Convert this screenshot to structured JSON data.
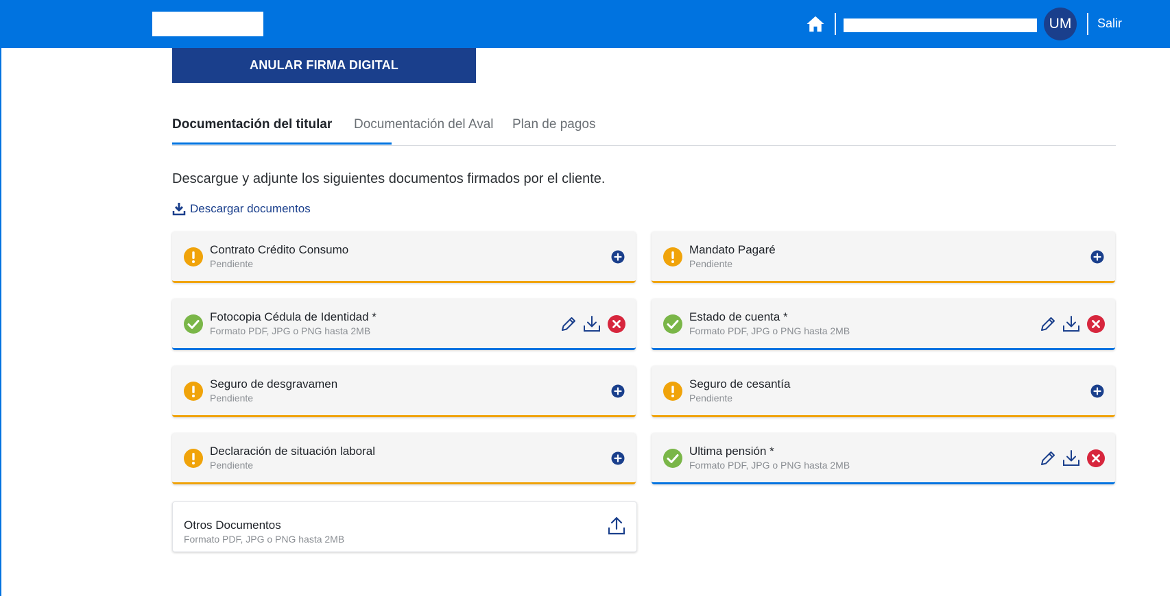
{
  "header": {
    "avatar_initials": "UM",
    "logout_label": "Salir",
    "bar_color": "#0073e0"
  },
  "annul_button_label": "ANULAR FIRMA DIGITAL",
  "tabs": [
    {
      "label": "Documentación del titular",
      "active": true
    },
    {
      "label": "Documentación del Aval",
      "active": false
    },
    {
      "label": "Plan de pagos",
      "active": false
    }
  ],
  "intro_text": "Descargue y adjunte los siguientes documentos firmados por el cliente.",
  "download_link_label": "Descargar documentos",
  "documents": [
    {
      "title": "Contrato Crédito Consumo",
      "subtitle": "Pendiente",
      "status": "pending"
    },
    {
      "title": "Mandato Pagaré",
      "subtitle": "Pendiente",
      "status": "pending"
    },
    {
      "title": "Fotocopia Cédula de Identidad *",
      "subtitle": "Formato PDF, JPG o PNG hasta 2MB",
      "status": "done"
    },
    {
      "title": "Estado de cuenta *",
      "subtitle": "Formato PDF, JPG o PNG hasta 2MB",
      "status": "done"
    },
    {
      "title": "Seguro de desgravamen",
      "subtitle": "Pendiente",
      "status": "pending"
    },
    {
      "title": "Seguro de cesantía",
      "subtitle": "Pendiente",
      "status": "pending"
    },
    {
      "title": "Declaración de situación laboral",
      "subtitle": "Pendiente",
      "status": "pending"
    },
    {
      "title": "Ultima pensión *",
      "subtitle": "Formato PDF, JPG o PNG hasta 2MB",
      "status": "done"
    }
  ],
  "other_documents": {
    "title": "Otros Documentos",
    "subtitle": "Formato PDF, JPG o PNG hasta 2MB"
  },
  "colors": {
    "primary": "#0073e0",
    "navy": "#1a3f8c",
    "warning": "#f0a30a",
    "success": "#7ab648",
    "danger": "#d7263d"
  },
  "icons": {
    "pending": "warning-icon",
    "done": "check-icon",
    "edit": "pencil-icon",
    "download": "download-icon",
    "delete": "delete-icon",
    "add": "plus-icon",
    "upload": "upload-icon"
  }
}
